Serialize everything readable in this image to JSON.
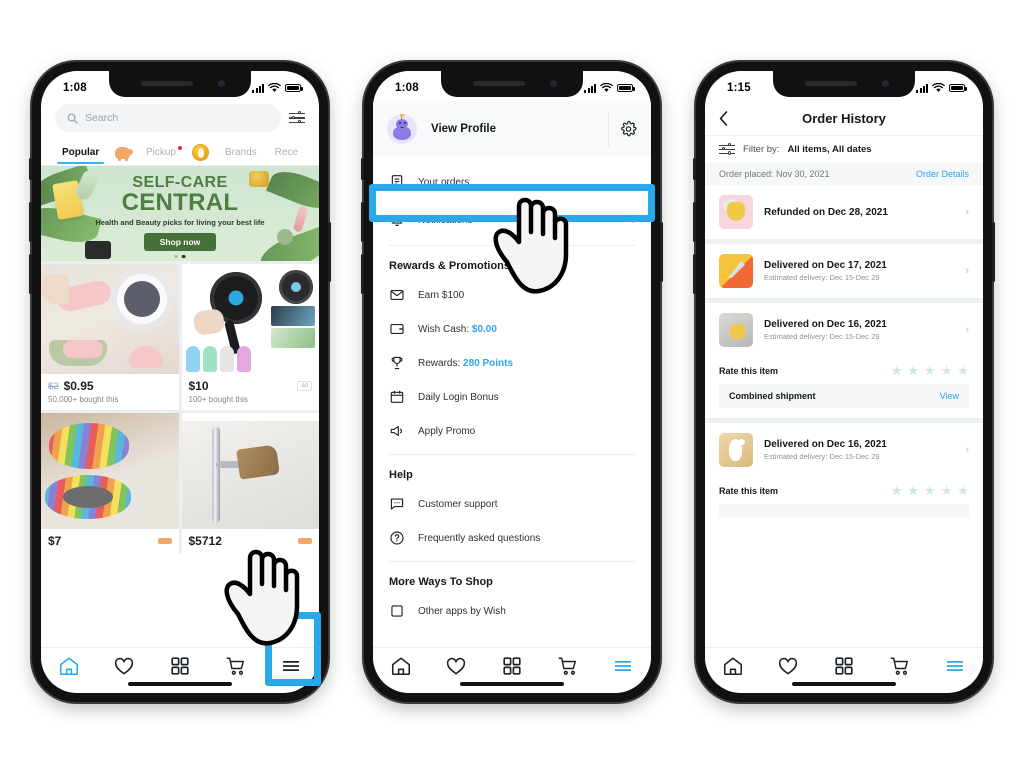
{
  "phone1": {
    "status": {
      "time": "1:08",
      "signal_icon": "cellular-icon",
      "wifi_icon": "wifi-icon",
      "battery_icon": "battery-icon"
    },
    "search": {
      "placeholder": "Search",
      "icon": "search-icon",
      "filter_icon": "sliders-icon"
    },
    "tabs": [
      {
        "label": "Popular",
        "active": true,
        "badge": false,
        "type": "text"
      },
      {
        "label": "",
        "active": false,
        "badge": false,
        "type": "piggy-icon"
      },
      {
        "label": "Pickup",
        "active": false,
        "badge": true,
        "type": "text"
      },
      {
        "label": "",
        "active": false,
        "badge": true,
        "type": "coin-icon"
      },
      {
        "label": "Brands",
        "active": false,
        "badge": false,
        "type": "text"
      },
      {
        "label": "Rece",
        "active": false,
        "badge": false,
        "type": "text"
      }
    ],
    "banner": {
      "title_line1": "SELF-CARE",
      "title_line2": "CENTRAL",
      "subtitle": "Health and Beauty picks for living your best life",
      "cta": "Shop now",
      "dots": 2,
      "active_dot": 2
    },
    "products": [
      {
        "price_old": "$2",
        "price_new": "$0.95",
        "bought": "50,000+ bought this",
        "ad": ""
      },
      {
        "price_old": "",
        "price_new": "$10",
        "bought": "100+ bought this",
        "ad": "ad"
      },
      {
        "price_old": "",
        "price_new": "$7",
        "bought": "",
        "ad": ""
      },
      {
        "price_old": "",
        "price_new": "$5712",
        "bought": "",
        "ad": ""
      }
    ],
    "tabbar": [
      {
        "name": "home-icon",
        "label": "Home",
        "active": true
      },
      {
        "name": "heart-icon",
        "label": "Wishlist",
        "active": false
      },
      {
        "name": "grid-icon",
        "label": "Categories",
        "active": false
      },
      {
        "name": "cart-icon",
        "label": "Cart",
        "active": false
      },
      {
        "name": "menu-icon",
        "label": "Menu",
        "active": false
      }
    ],
    "highlight": {
      "target": "menu-icon",
      "color": "#29a9ea"
    },
    "cursor": {
      "present": true,
      "over": "menu-icon"
    }
  },
  "phone2": {
    "status": {
      "time": "1:08"
    },
    "profile": {
      "label": "View Profile",
      "avatar": "avatar-icon",
      "settings_icon": "gear-icon"
    },
    "top_items": [
      {
        "label": "Your orders",
        "icon": "receipt-icon",
        "badge": false,
        "highlighted": true
      },
      {
        "label": "Notifications",
        "icon": "bell-icon",
        "badge": true,
        "highlighted": false
      }
    ],
    "sections": [
      {
        "title": "Rewards & Promotions",
        "items": [
          {
            "label": "Earn $100",
            "icon": "envelope-icon",
            "value": "",
            "value_color": ""
          },
          {
            "label": "Wish Cash:",
            "icon": "wallet-icon",
            "value": "$0.00",
            "value_color": "#2fa8e8"
          },
          {
            "label": "Rewards:",
            "icon": "trophy-icon",
            "value": "280 Points",
            "value_color": "#2fa8e8"
          },
          {
            "label": "Daily Login Bonus",
            "icon": "calendar-icon",
            "value": "",
            "value_color": ""
          },
          {
            "label": "Apply Promo",
            "icon": "megaphone-icon",
            "value": "",
            "value_color": ""
          }
        ]
      },
      {
        "title": "Help",
        "items": [
          {
            "label": "Customer support",
            "icon": "chat-icon",
            "value": "",
            "value_color": ""
          },
          {
            "label": "Frequently asked questions",
            "icon": "question-circle-icon",
            "value": "",
            "value_color": ""
          }
        ]
      },
      {
        "title": "More Ways To Shop",
        "items": [
          {
            "label": "Other apps by Wish",
            "icon": "app-icon",
            "value": "",
            "value_color": ""
          }
        ]
      }
    ],
    "tabbar": [
      {
        "name": "home-icon",
        "active": false
      },
      {
        "name": "heart-icon",
        "active": false
      },
      {
        "name": "grid-icon",
        "active": false
      },
      {
        "name": "cart-icon",
        "active": false
      },
      {
        "name": "menu-icon",
        "active": true
      }
    ],
    "highlight": {
      "target": "your-orders-row",
      "color": "#29a9ea"
    },
    "cursor": {
      "present": true,
      "over": "your-orders-row"
    }
  },
  "phone3": {
    "status": {
      "time": "1:15"
    },
    "nav": {
      "back_icon": "chevron-left-icon",
      "title": "Order History"
    },
    "filter": {
      "icon": "sliders-icon",
      "label": "Filter by:",
      "value": "All items, All dates"
    },
    "order_placed": {
      "label": "Order placed: Nov 30, 2021",
      "link": "Order Details"
    },
    "orders": [
      {
        "status": "Refunded on Dec 28, 2021",
        "estimate": "",
        "thumb": "th-pink",
        "rate": false,
        "combined": false
      },
      {
        "status": "Delivered on Dec 17, 2021",
        "estimate": "Estimated delivery: Dec 15-Dec 29",
        "thumb": "th-orange",
        "rate": false,
        "combined": false
      },
      {
        "status": "Delivered on Dec 16, 2021",
        "estimate": "Estimated delivery: Dec 15-Dec 29",
        "thumb": "th-gray",
        "rate": true,
        "combined": true
      },
      {
        "status": "Delivered on Dec 16, 2021",
        "estimate": "Estimated delivery: Dec 15-Dec 29",
        "thumb": "th-wood",
        "rate": true,
        "combined": false
      }
    ],
    "rate_label": "Rate this item",
    "stars_count": 5,
    "combined_shipment": {
      "label": "Combined shipment",
      "link": "View"
    },
    "tabbar": [
      {
        "name": "home-icon",
        "active": false
      },
      {
        "name": "heart-icon",
        "active": false
      },
      {
        "name": "grid-icon",
        "active": false
      },
      {
        "name": "cart-icon",
        "active": false
      },
      {
        "name": "menu-icon",
        "active": true
      }
    ]
  },
  "colors": {
    "accent_blue": "#29a9ea",
    "link_blue": "#2fa8e8",
    "badge_red": "#ef2b2b",
    "banner_green": "#4f7e43",
    "frame_black": "#111111"
  }
}
